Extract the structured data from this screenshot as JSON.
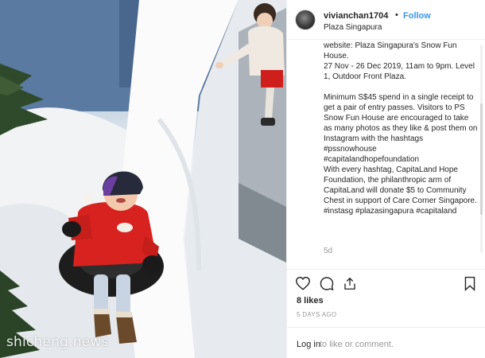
{
  "post": {
    "username": "vivianchan1704",
    "separator": "•",
    "follow_label": "Follow",
    "location": "Plaza Singapura"
  },
  "caption": {
    "para1": "website:  Plaza Singapura's Snow Fun House.\n27 Nov - 26 Dec 2019, 11am to 9pm. Level 1, Outdoor Front Plaza.",
    "para2": "Minimum S$45 spend in a single receipt to get a pair of entry passes. Visitors to PS Snow Fun House are encouraged to take as many photos as they like & post them on Instagram with the hashtags #pssnowhouse\n#capitalandhopefoundation\nWith every hashtag, CapitaLand Hope Foundation, the philanthropic arm of CapitaLand will donate $5 to Community Chest in support of Care Corner Singapore.\n#instasg #plazasingapura #capitaland",
    "time_ago": "5d"
  },
  "actions": {
    "like_icon": "heart-icon",
    "comment_icon": "comment-icon",
    "share_icon": "share-icon",
    "save_icon": "bookmark-icon",
    "likes_text": "8 likes",
    "date_text": "5 DAYS AGO"
  },
  "comment_bar": {
    "login_label": "Log in",
    "rest_text": "to like or comment."
  },
  "image": {
    "watermark": "shicheng.news"
  },
  "colors": {
    "link_blue": "#3897f0",
    "text": "#262626",
    "muted": "#999999",
    "jacket_red": "#d8221f"
  }
}
